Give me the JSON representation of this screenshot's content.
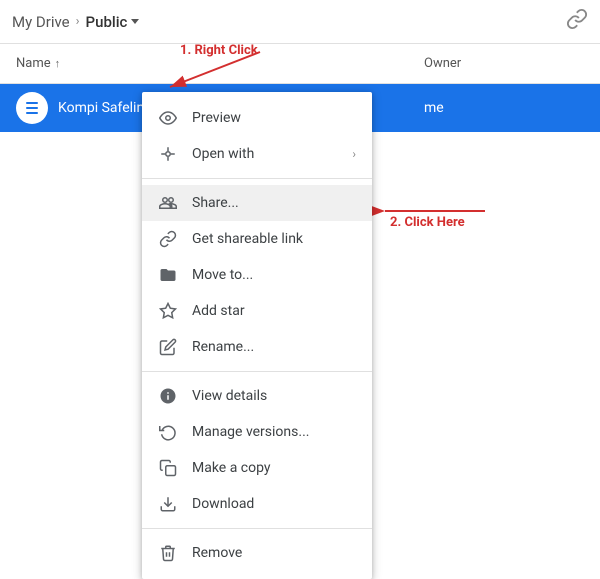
{
  "header": {
    "mydrive_label": "My Drive",
    "breadcrumb_sep": ">",
    "current_folder": "Public",
    "link_icon": "🔗"
  },
  "columns": {
    "name_label": "Name",
    "sort_icon": "↑",
    "owner_label": "Owner"
  },
  "file_row": {
    "name": "Kompi Safelink W",
    "owner": "me"
  },
  "context_menu": {
    "items": [
      {
        "id": "preview",
        "label": "Preview",
        "icon": "eye"
      },
      {
        "id": "open-with",
        "label": "Open with",
        "icon": "open-with",
        "has_arrow": true
      },
      {
        "id": "share",
        "label": "Share...",
        "icon": "share",
        "active": true
      },
      {
        "id": "get-link",
        "label": "Get shareable link",
        "icon": "link"
      },
      {
        "id": "move-to",
        "label": "Move to...",
        "icon": "folder"
      },
      {
        "id": "add-star",
        "label": "Add star",
        "icon": "star"
      },
      {
        "id": "rename",
        "label": "Rename...",
        "icon": "rename"
      },
      {
        "id": "view-details",
        "label": "View details",
        "icon": "info"
      },
      {
        "id": "manage-versions",
        "label": "Manage versions...",
        "icon": "history"
      },
      {
        "id": "make-copy",
        "label": "Make a copy",
        "icon": "copy"
      },
      {
        "id": "download",
        "label": "Download",
        "icon": "download"
      },
      {
        "id": "remove",
        "label": "Remove",
        "icon": "trash"
      }
    ]
  },
  "annotations": {
    "step1": "1. Right Click",
    "step2": "2. Click Here"
  }
}
